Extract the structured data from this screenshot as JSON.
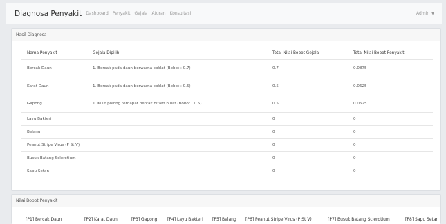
{
  "navbar": {
    "brand": "Diagnosa Penyakit",
    "links": [
      "Dashboard",
      "Penyakit",
      "Gejala",
      "Aturan",
      "Konsultasi"
    ],
    "user": "Admin"
  },
  "hasil": {
    "title": "Hasil Diagnosa",
    "columns": [
      "Nama Penyakit",
      "Gejala Dipilih",
      "Total Nilai Bobot Gejala",
      "Total Nilai Bobot Penyakit"
    ],
    "rows": [
      [
        "Bercak Daun",
        "1. Bercak pada daun berwarna coklat (Bobot : 0.7)",
        "0.7",
        "0.0875"
      ],
      [
        "Karat Daun",
        "1. Bercak pada daun berwarna coklat (Bobot : 0.5)",
        "0.5",
        "0.0625"
      ],
      [
        "Gapong",
        "1. Kulit polong terdapat bercak hitam bulat (Bobot : 0.5)",
        "0.5",
        "0.0625"
      ],
      [
        "Layu Bakteri",
        "",
        "0",
        "0"
      ],
      [
        "Belang",
        "",
        "0",
        "0"
      ],
      [
        "Peanut Stripe Virus (P St V)",
        "",
        "0",
        "0"
      ],
      [
        "Busuk Batang Sclerotium",
        "",
        "0",
        "0"
      ],
      [
        "Sapu Setan",
        "",
        "0",
        "0"
      ]
    ]
  },
  "bobot": {
    "title": "Nilai Bobot Penyakit",
    "items": [
      "[P1] Bercak Daun",
      "[P2] Karat Daun",
      "[P3] Gapong",
      "[P4] Layu Bakteri",
      "[P5] Belang",
      "[P6] Peanut Stripe Virus (P St V)",
      "[P7] Busuk Batang Sclerotium",
      "[P8] Sapu Setan"
    ]
  }
}
